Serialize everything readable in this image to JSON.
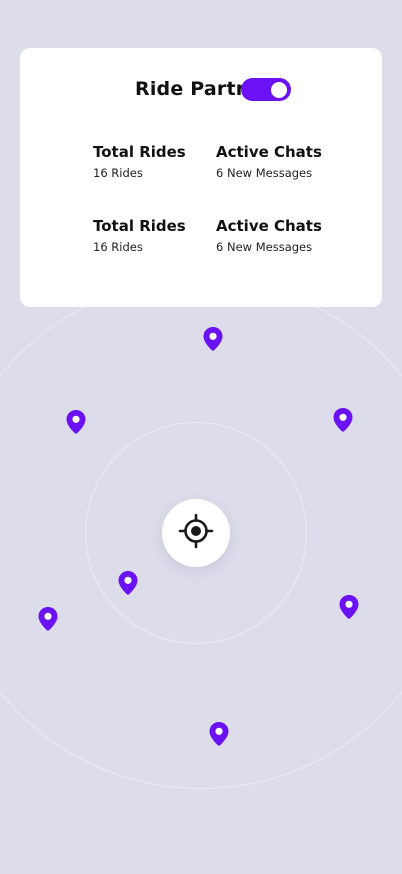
{
  "card": {
    "title": "Ride Partner",
    "toggle_on": true,
    "stats": [
      {
        "label": "Total Rides",
        "value": "16 Rides"
      },
      {
        "label": "Active Chats",
        "value": "6 New Messages"
      },
      {
        "label": "Total Rides",
        "value": "16 Rides"
      },
      {
        "label": "Active Chats",
        "value": "6 New Messages"
      }
    ]
  },
  "map": {
    "center_icon": "crosshair-locate-icon",
    "pin_icon": "map-pin-icon",
    "pin_count": 7
  },
  "colors": {
    "background": "#dcdcea",
    "accent": "#6a12f3",
    "card": "#ffffff"
  }
}
